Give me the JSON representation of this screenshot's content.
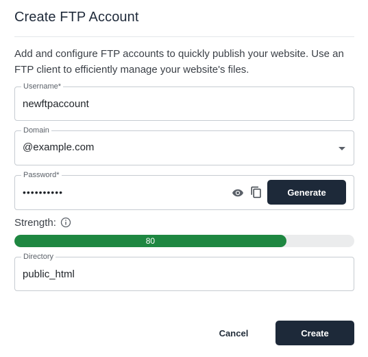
{
  "dialog": {
    "title": "Create FTP Account",
    "description": "Add and configure FTP accounts to quickly publish your website. Use an FTP client to efficiently manage your website's files."
  },
  "form": {
    "username": {
      "label": "Username*",
      "value": "newftpaccount"
    },
    "domain": {
      "label": "Domain",
      "value": "@example.com"
    },
    "password": {
      "label": "Password*",
      "value": "••••••••••",
      "generate_label": "Generate"
    },
    "strength": {
      "label": "Strength:",
      "value": 80,
      "value_text": "80",
      "color": "#1e8741"
    },
    "directory": {
      "label": "Directory",
      "value": "public_html"
    }
  },
  "actions": {
    "cancel_label": "Cancel",
    "create_label": "Create"
  },
  "icons": [
    "eye-icon",
    "copy-icon",
    "info-icon",
    "chevron-down-icon"
  ],
  "colors": {
    "primary_button": "#1d2939",
    "strength_fill": "#1e8741",
    "strength_track": "#ebeced"
  }
}
